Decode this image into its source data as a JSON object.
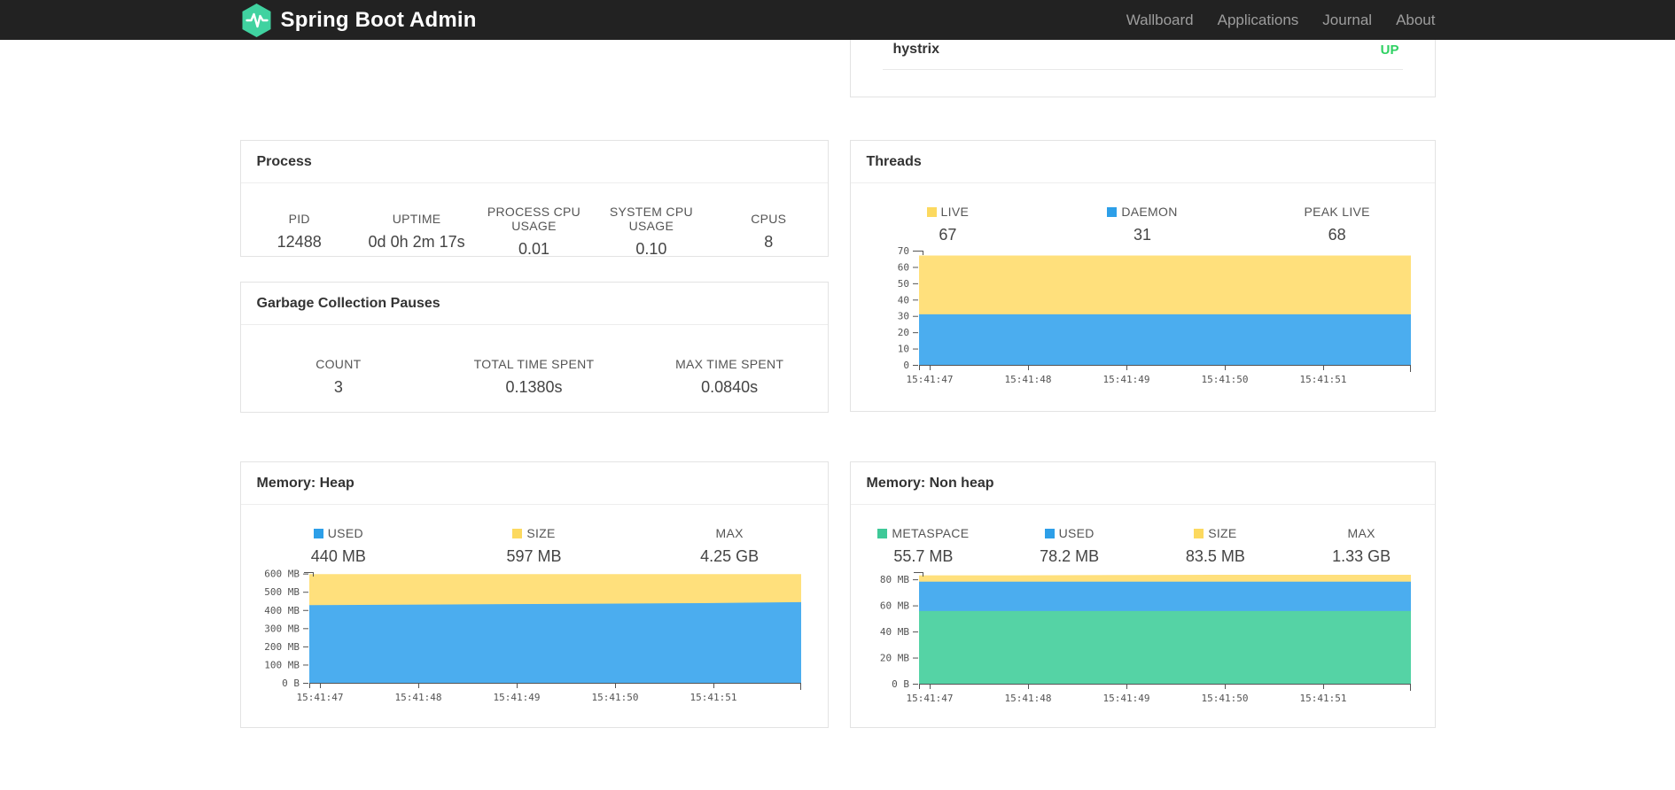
{
  "colors": {
    "brand_green": "#40d2a0",
    "status_up": "#2ed162",
    "chart_blue": "#4badef",
    "chart_yellow": "#ffe07c",
    "chart_green": "#55d3a5",
    "swatch_blue": "#2d9fe8",
    "swatch_yellow": "#fcd95f",
    "swatch_green": "#3ec998"
  },
  "navbar": {
    "brand": "Spring Boot Admin",
    "links": [
      {
        "label": "Wallboard"
      },
      {
        "label": "Applications"
      },
      {
        "label": "Journal"
      },
      {
        "label": "About"
      }
    ]
  },
  "status_card": {
    "app_name": "hystrix",
    "status": "UP"
  },
  "cards": {
    "process": {
      "title": "Process",
      "metrics": [
        {
          "label": "PID",
          "value": "12488"
        },
        {
          "label": "UPTIME",
          "value": "0d 0h 2m 17s"
        },
        {
          "label": "PROCESS CPU USAGE",
          "value": "0.01"
        },
        {
          "label": "SYSTEM CPU USAGE",
          "value": "0.10"
        },
        {
          "label": "CPUS",
          "value": "8"
        }
      ]
    },
    "gc": {
      "title": "Garbage Collection Pauses",
      "metrics": [
        {
          "label": "COUNT",
          "value": "3"
        },
        {
          "label": "TOTAL TIME SPENT",
          "value": "0.1380s"
        },
        {
          "label": "MAX TIME SPENT",
          "value": "0.0840s"
        }
      ]
    },
    "threads": {
      "title": "Threads",
      "metrics": [
        {
          "label": "LIVE",
          "value": "67",
          "swatch": "#fcd95f"
        },
        {
          "label": "DAEMON",
          "value": "31",
          "swatch": "#2d9fe8"
        },
        {
          "label": "PEAK LIVE",
          "value": "68",
          "swatch": null
        }
      ]
    },
    "heap": {
      "title": "Memory: Heap",
      "metrics": [
        {
          "label": "USED",
          "value": "440 MB",
          "swatch": "#2d9fe8"
        },
        {
          "label": "SIZE",
          "value": "597 MB",
          "swatch": "#fcd95f"
        },
        {
          "label": "MAX",
          "value": "4.25 GB",
          "swatch": null
        }
      ]
    },
    "nonheap": {
      "title": "Memory: Non heap",
      "metrics": [
        {
          "label": "METASPACE",
          "value": "55.7 MB",
          "swatch": "#3ec998"
        },
        {
          "label": "USED",
          "value": "78.2 MB",
          "swatch": "#2d9fe8"
        },
        {
          "label": "SIZE",
          "value": "83.5 MB",
          "swatch": "#fcd95f"
        },
        {
          "label": "MAX",
          "value": "1.33 GB",
          "swatch": null
        }
      ]
    }
  },
  "chart_data": [
    {
      "id": "threads",
      "type": "area",
      "stacked": true,
      "title": "Threads",
      "x_labels": [
        "15:41:47",
        "15:41:48",
        "15:41:49",
        "15:41:50",
        "15:41:51"
      ],
      "ylim": [
        0,
        70
      ],
      "yticks": [
        {
          "v": 0,
          "label": "0"
        },
        {
          "v": 10,
          "label": "10"
        },
        {
          "v": 20,
          "label": "20"
        },
        {
          "v": 30,
          "label": "30"
        },
        {
          "v": 40,
          "label": "40"
        },
        {
          "v": 50,
          "label": "50"
        },
        {
          "v": 60,
          "label": "60"
        },
        {
          "v": 70,
          "label": "70"
        }
      ],
      "series": [
        {
          "name": "DAEMON",
          "color": "#4badef",
          "values": [
            31,
            31,
            31,
            31,
            31,
            31
          ]
        },
        {
          "name": "LIVE",
          "color": "#ffe07c",
          "values": [
            67,
            67,
            67,
            67,
            67,
            67
          ]
        }
      ]
    },
    {
      "id": "heap",
      "type": "area",
      "stacked": true,
      "title": "Memory: Heap",
      "x_labels": [
        "15:41:47",
        "15:41:48",
        "15:41:49",
        "15:41:50",
        "15:41:51"
      ],
      "ylim": [
        0,
        608
      ],
      "yticks": [
        {
          "v": 0,
          "label": "0 B"
        },
        {
          "v": 100,
          "label": "100 MB"
        },
        {
          "v": 200,
          "label": "200 MB"
        },
        {
          "v": 300,
          "label": "300 MB"
        },
        {
          "v": 400,
          "label": "400 MB"
        },
        {
          "v": 500,
          "label": "500 MB"
        },
        {
          "v": 600,
          "label": "600 MB"
        }
      ],
      "series": [
        {
          "name": "USED",
          "color": "#4badef",
          "values": [
            427,
            429,
            432,
            435,
            438,
            443
          ]
        },
        {
          "name": "SIZE",
          "color": "#ffe07c",
          "values": [
            597,
            597,
            597,
            597,
            597,
            597
          ]
        }
      ]
    },
    {
      "id": "nonheap",
      "type": "area",
      "stacked": true,
      "title": "Memory: Non heap",
      "x_labels": [
        "15:41:47",
        "15:41:48",
        "15:41:49",
        "15:41:50",
        "15:41:51"
      ],
      "ylim": [
        0,
        85.5
      ],
      "yticks": [
        {
          "v": 0,
          "label": "0 B"
        },
        {
          "v": 20,
          "label": "20 MB"
        },
        {
          "v": 40,
          "label": "40 MB"
        },
        {
          "v": 60,
          "label": "60 MB"
        },
        {
          "v": 80,
          "label": "80 MB"
        }
      ],
      "series": [
        {
          "name": "METASPACE",
          "color": "#55d3a5",
          "values": [
            55.7,
            55.7,
            55.7,
            55.7,
            55.7,
            55.7
          ]
        },
        {
          "name": "USED",
          "color": "#4badef",
          "values": [
            78.2,
            78.2,
            78.2,
            78.2,
            78.2,
            78.2
          ]
        },
        {
          "name": "SIZE",
          "color": "#ffe07c",
          "values": [
            83,
            83,
            83.3,
            83.5,
            83.5,
            83.5
          ]
        }
      ]
    }
  ]
}
